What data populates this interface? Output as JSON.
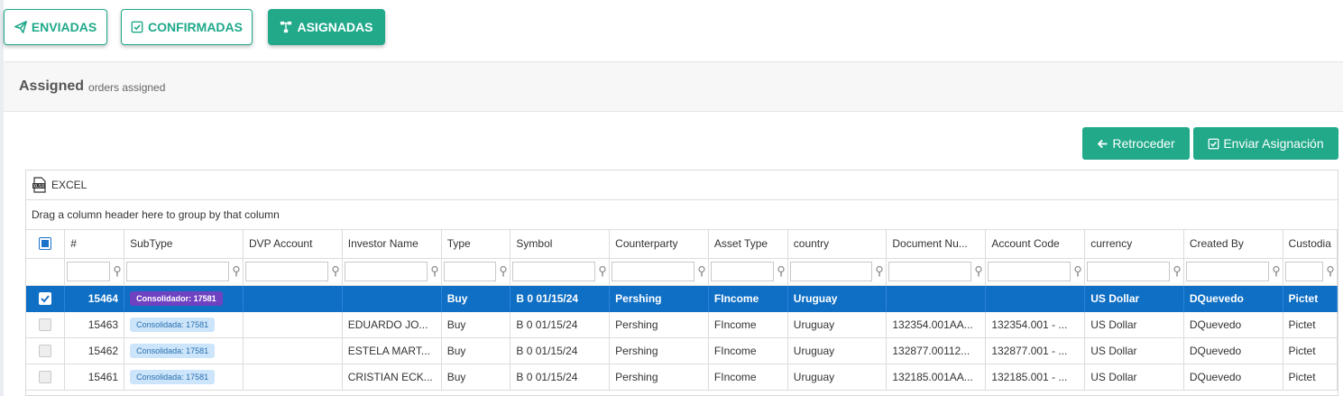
{
  "tabs": [
    {
      "label": "ENVIADAS",
      "icon": "paper-plane-icon"
    },
    {
      "label": "CONFIRMADAS",
      "icon": "checkbox-icon"
    },
    {
      "label": "ASIGNADAS",
      "icon": "sitemap-icon"
    }
  ],
  "panel": {
    "title": "Assigned",
    "subtitle": "orders assigned"
  },
  "actions": {
    "back_label": "Retroceder",
    "send_label": "Enviar Asignación"
  },
  "grid": {
    "excel_label": "EXCEL",
    "group_hint": "Drag a column header here to group by that column",
    "columns": [
      "#",
      "SubType",
      "DVP Account",
      "Investor Name",
      "Type",
      "Symbol",
      "Counterparty",
      "Asset Type",
      "country",
      "Document Nu...",
      "Account Code",
      "currency",
      "Created By",
      "Custodia"
    ],
    "rows": [
      {
        "selected": true,
        "id": "15464",
        "subtype": "Consolidador: 17581",
        "dvp": "",
        "investor": "",
        "type": "Buy",
        "symbol": "B 0 01/15/24",
        "counterparty": "Pershing",
        "asset_type": "FIncome",
        "country": "Uruguay",
        "document": "",
        "account": "",
        "currency": "US Dollar",
        "created_by": "DQuevedo",
        "custodian": "Pictet"
      },
      {
        "selected": false,
        "id": "15463",
        "subtype": "Consolidada: 17581",
        "dvp": "",
        "investor": "EDUARDO JO...",
        "type": "Buy",
        "symbol": "B 0 01/15/24",
        "counterparty": "Pershing",
        "asset_type": "FIncome",
        "country": "Uruguay",
        "document": "132354.001AA...",
        "account": "132354.001 - ...",
        "currency": "US Dollar",
        "created_by": "DQuevedo",
        "custodian": "Pictet"
      },
      {
        "selected": false,
        "id": "15462",
        "subtype": "Consolidada: 17581",
        "dvp": "",
        "investor": "ESTELA MART...",
        "type": "Buy",
        "symbol": "B 0 01/15/24",
        "counterparty": "Pershing",
        "asset_type": "FIncome",
        "country": "Uruguay",
        "document": "132877.00112...",
        "account": "132877.001 - ...",
        "currency": "US Dollar",
        "created_by": "DQuevedo",
        "custodian": "Pictet"
      },
      {
        "selected": false,
        "id": "15461",
        "subtype": "Consolidada: 17581",
        "dvp": "",
        "investor": "CRISTIAN ECK...",
        "type": "Buy",
        "symbol": "B 0 01/15/24",
        "counterparty": "Pershing",
        "asset_type": "FIncome",
        "country": "Uruguay",
        "document": "132185.001AA...",
        "account": "132185.001 - ...",
        "currency": "US Dollar",
        "created_by": "DQuevedo",
        "custodian": "Pictet"
      }
    ]
  },
  "colors": {
    "accent": "#21a98a",
    "selection": "#0f6fc5",
    "badge_purple": "#6f42c1",
    "badge_light": "#cce5fa"
  }
}
